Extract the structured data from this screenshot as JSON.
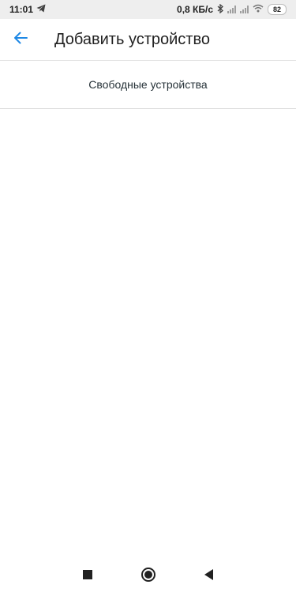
{
  "status_bar": {
    "time": "11:01",
    "net_speed": "0,8 КБ/с",
    "battery": "82",
    "icons": [
      "telegram-icon",
      "bluetooth-icon",
      "signal-icon",
      "signal-icon",
      "wifi-icon",
      "battery-icon"
    ]
  },
  "app_bar": {
    "title": "Добавить устройство",
    "back_icon": "arrow-left-icon",
    "accent": "#1e88e5"
  },
  "content": {
    "section_title": "Свободные устройства",
    "devices": []
  },
  "nav_bar": {
    "icons": [
      "recent-apps-icon",
      "home-icon",
      "back-icon"
    ]
  }
}
